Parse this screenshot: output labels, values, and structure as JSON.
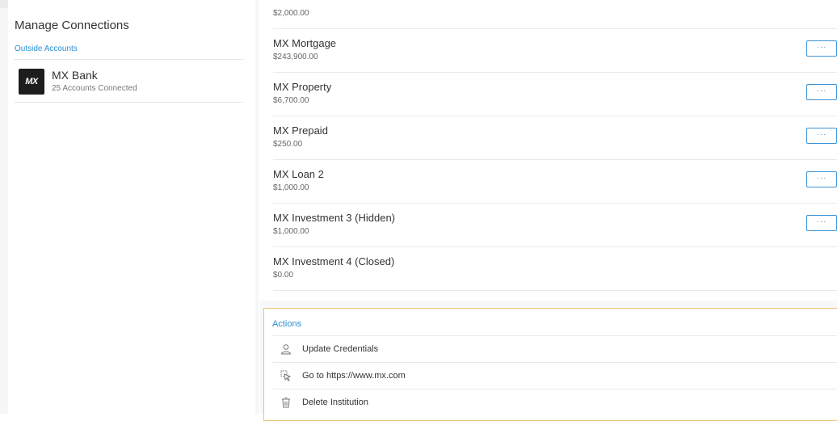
{
  "left": {
    "title": "Manage Connections",
    "section_label": "Outside Accounts",
    "institutions": [
      {
        "logo_text": "MX",
        "name": "MX Bank",
        "subtitle": "25 Accounts Connected"
      }
    ]
  },
  "accounts": [
    {
      "name": "",
      "balance": "$2,000.00",
      "has_menu": true
    },
    {
      "name": "MX Mortgage",
      "balance": "$243,900.00",
      "has_menu": true
    },
    {
      "name": "MX Property",
      "balance": "$6,700.00",
      "has_menu": true
    },
    {
      "name": "MX Prepaid",
      "balance": "$250.00",
      "has_menu": true
    },
    {
      "name": "MX Loan 2",
      "balance": "$1,000.00",
      "has_menu": true
    },
    {
      "name": "MX Investment 3 (Hidden)",
      "balance": "$1,000.00",
      "has_menu": true
    },
    {
      "name": "MX Investment 4 (Closed)",
      "balance": "$0.00",
      "has_menu": false
    }
  ],
  "menu_button_label": "···",
  "actions": {
    "title": "Actions",
    "items": [
      {
        "label": "Update Credentials",
        "icon": "user-icon"
      },
      {
        "label": "Go to https://www.mx.com",
        "icon": "pointer-icon"
      },
      {
        "label": "Delete Institution",
        "icon": "trash-icon"
      }
    ]
  },
  "colors": {
    "accent": "#2a8ed2",
    "button_border": "#3b93d6",
    "actions_border": "#e9c66a",
    "logo_bg": "#1d1d1f"
  }
}
